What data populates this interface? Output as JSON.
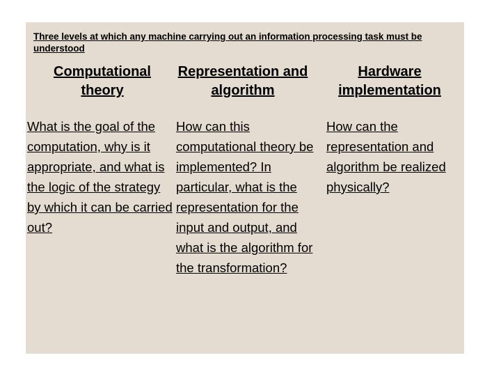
{
  "slide": {
    "background_color": "#E4DCD0",
    "page_background_color": "#FFFFFF",
    "text_color": "#000000",
    "title": "Three levels at which any machine carrying out an information processing task must be understood",
    "columns": [
      {
        "header": "Computational theory",
        "body": "What is the goal of the computation, why is it appropriate, and what is the logic of the strategy by which it can be carried out?"
      },
      {
        "header": "Representation and algorithm",
        "body": "How can this computational theory be implemented? In particular, what is the representation for the input and output, and what is the algorithm for the transformation?"
      },
      {
        "header": "Hardware implementation",
        "body": "How can the representation and algorithm be realized physically?"
      }
    ]
  }
}
